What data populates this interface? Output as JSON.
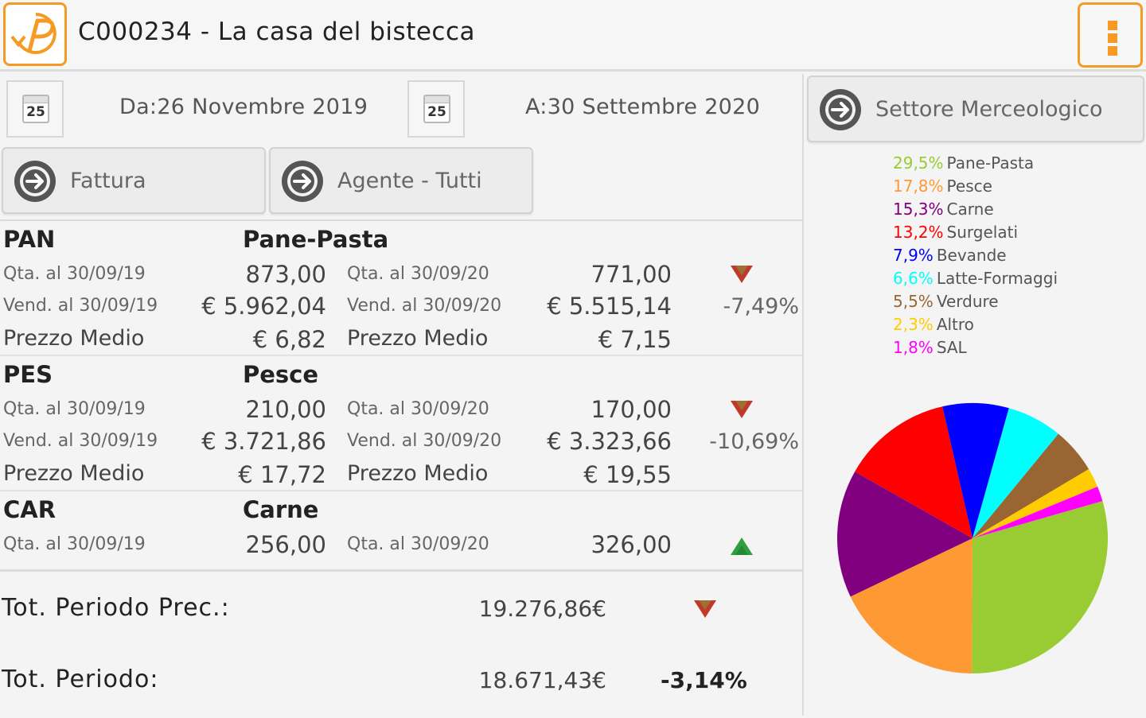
{
  "header": {
    "title": "C000234 - La casa del bistecca",
    "logo_icon": "p-arrow-logo-icon",
    "menu_icon": "vertical-dots-icon"
  },
  "filters": {
    "calendar_day": "25",
    "from_date": "Da:26 Novembre 2019",
    "to_date": "A:30 Settembre 2020",
    "document_type": "Fattura",
    "agent": "Agente - Tutti",
    "sector": "Settore Merceologico"
  },
  "items": [
    {
      "code": "PAN",
      "name": "Pane-Pasta",
      "qty_prev_label": "Qta. al 30/09/19",
      "qty_prev": "873,00",
      "qty_curr_label": "Qta. al 30/09/20",
      "qty_curr": "771,00",
      "sales_prev_label": "Vend. al 30/09/19",
      "sales_prev": "€ 5.962,04",
      "sales_curr_label": "Vend. al 30/09/20",
      "sales_curr": "€ 5.515,14",
      "change": "-7,49%",
      "trend": "down",
      "avg_label": "Prezzo Medio",
      "avg_prev": "€ 6,82",
      "avg_curr": "€ 7,15"
    },
    {
      "code": "PES",
      "name": "Pesce",
      "qty_prev_label": "Qta. al 30/09/19",
      "qty_prev": "210,00",
      "qty_curr_label": "Qta. al 30/09/20",
      "qty_curr": "170,00",
      "sales_prev_label": "Vend. al 30/09/19",
      "sales_prev": "€ 3.721,86",
      "sales_curr_label": "Vend. al 30/09/20",
      "sales_curr": "€ 3.323,66",
      "change": "-10,69%",
      "trend": "down",
      "avg_label": "Prezzo Medio",
      "avg_prev": "€ 17,72",
      "avg_curr": "€ 19,55"
    },
    {
      "code": "CAR",
      "name": "Carne",
      "qty_prev_label": "Qta. al 30/09/19",
      "qty_prev": "256,00",
      "qty_curr_label": "Qta. al 30/09/20",
      "qty_curr": "326,00",
      "trend": "up"
    }
  ],
  "totals": {
    "prev_label": "Tot. Periodo Prec.:",
    "prev_value": "19.276,86€",
    "prev_trend": "down",
    "curr_label": "Tot. Periodo:",
    "curr_value": "18.671,43€",
    "change": "-3,14%"
  },
  "chart_data": {
    "type": "pie",
    "slices": [
      {
        "label": "Pane-Pasta",
        "pct_label": "29,5%",
        "value": 29.5,
        "color": "#99cc33"
      },
      {
        "label": "Pesce",
        "pct_label": "17,8%",
        "value": 17.8,
        "color": "#ff9933"
      },
      {
        "label": "Carne",
        "pct_label": "15,3%",
        "value": 15.3,
        "color": "#800080"
      },
      {
        "label": "Surgelati",
        "pct_label": "13,2%",
        "value": 13.2,
        "color": "#ff0000"
      },
      {
        "label": "Bevande",
        "pct_label": "7,9%",
        "value": 7.9,
        "color": "#0000ff"
      },
      {
        "label": "Latte-Formaggi",
        "pct_label": "6,6%",
        "value": 6.6,
        "color": "#00ffff"
      },
      {
        "label": "Verdure",
        "pct_label": "5,5%",
        "value": 5.5,
        "color": "#996633"
      },
      {
        "label": "Altro",
        "pct_label": "2,3%",
        "value": 2.3,
        "color": "#ffcc00"
      },
      {
        "label": "SAL",
        "pct_label": "1,8%",
        "value": 1.8,
        "color": "#ff00ff"
      }
    ],
    "legend_position": "top"
  }
}
